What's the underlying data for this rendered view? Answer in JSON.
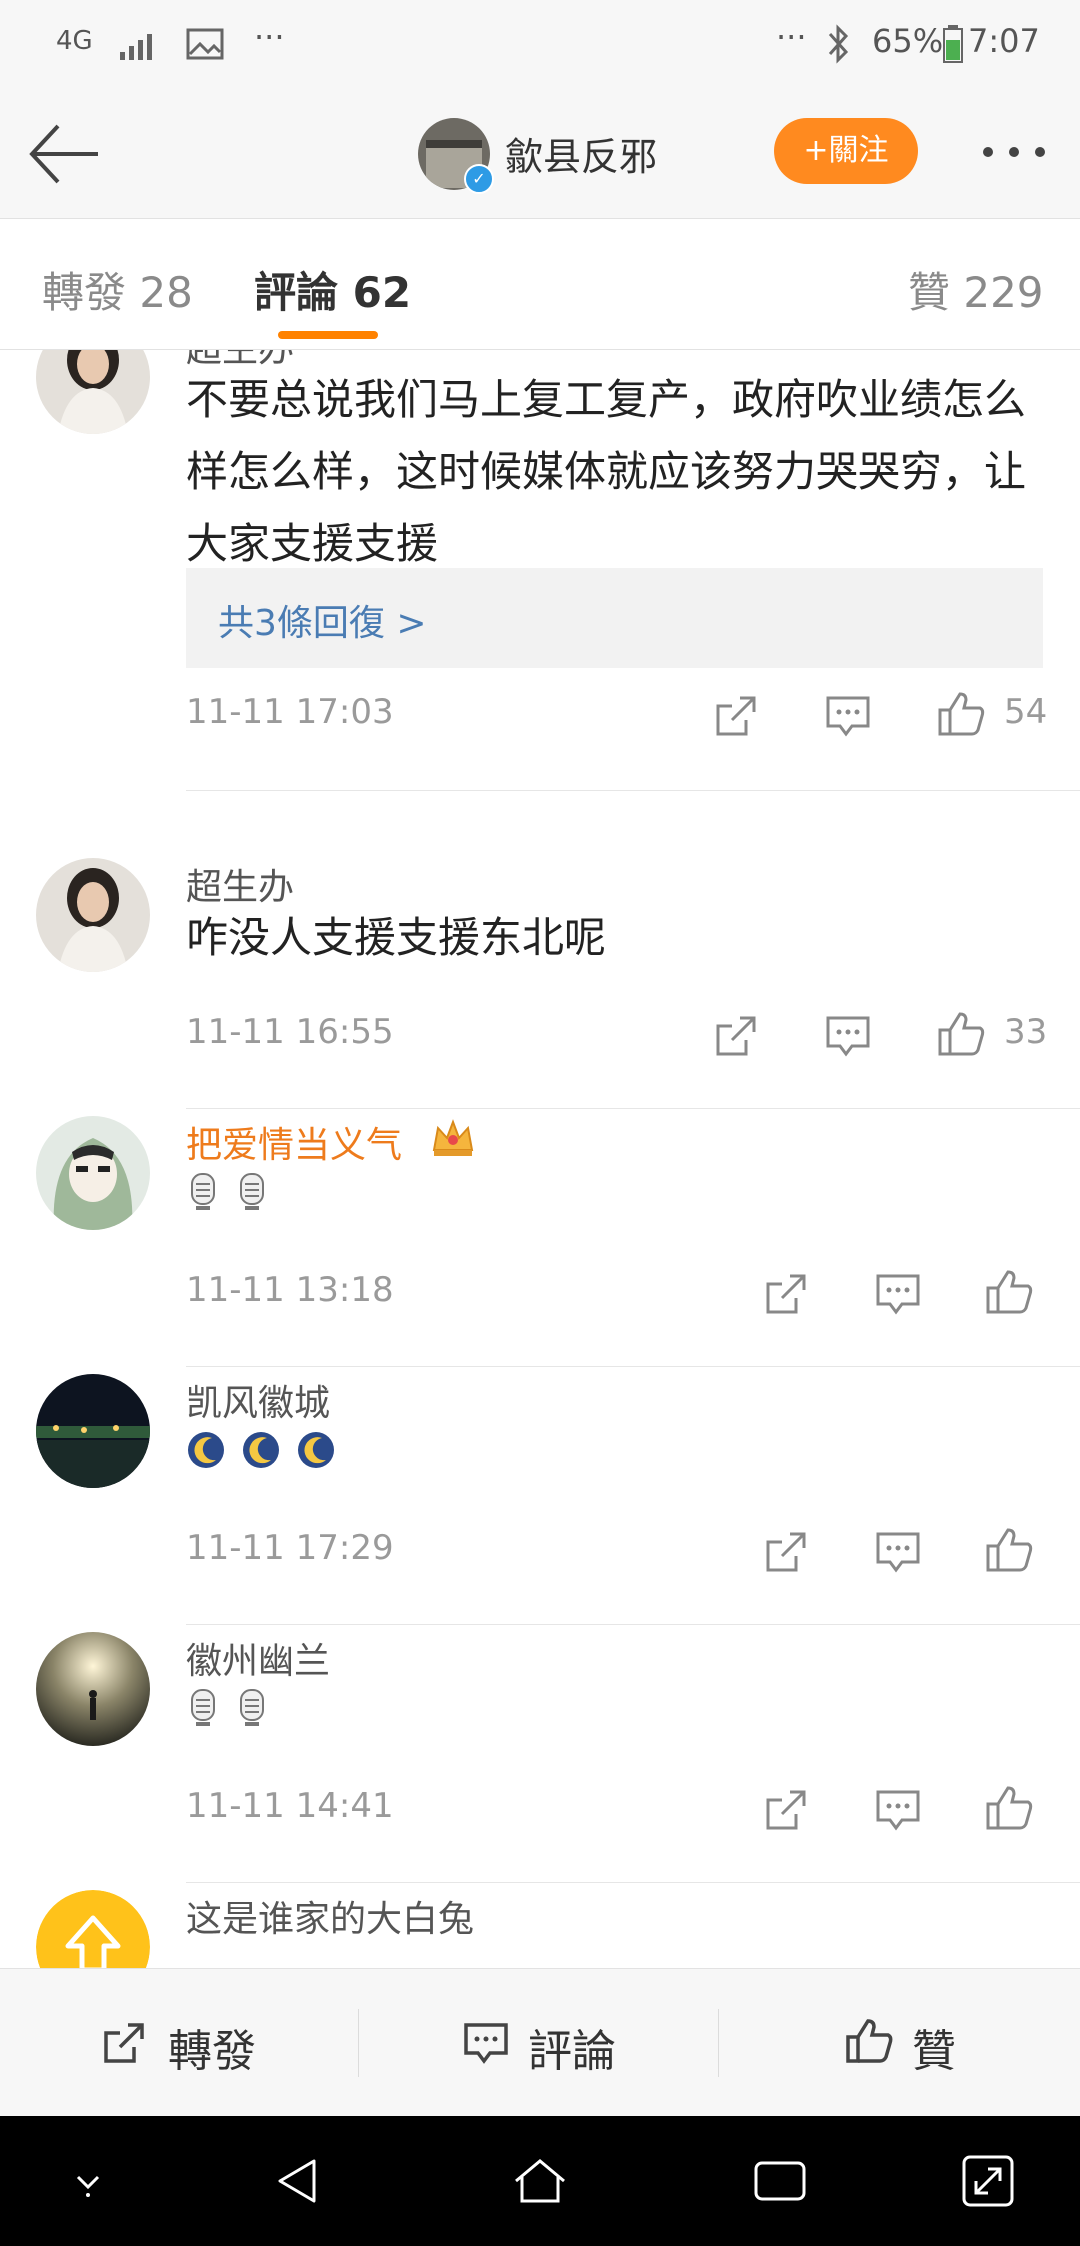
{
  "status_bar": {
    "network": "4G",
    "dots_left": "···",
    "dots_right": "···",
    "battery": "65%",
    "time": "7:07"
  },
  "header": {
    "account_name": "歙县反邪",
    "follow_label": "+關注"
  },
  "tabs": {
    "repost": "轉發 28",
    "comment": "評論 62",
    "like": "贊 229"
  },
  "comments": [
    {
      "name": "超生办",
      "text": "不要总说我们马上复工复产，政府吹业绩怎么样怎么样，这时候媒体就应该努力哭哭穷，让大家支援支援",
      "reply_link": "共3條回復 >",
      "time": "11-11 17:03",
      "likes": "54"
    },
    {
      "name": "超生办",
      "text": "咋没人支援支援东北呢",
      "time": "11-11 16:55",
      "likes": "33"
    },
    {
      "name": "把爱情当义气",
      "time": "11-11 13:18",
      "emoji": [
        "microphone-emoji",
        "microphone-emoji"
      ]
    },
    {
      "name": "凯风徽城",
      "time": "11-11 17:29",
      "emoji": [
        "moon-emoji",
        "moon-emoji",
        "moon-emoji"
      ]
    },
    {
      "name": "徽州幽兰",
      "time": "11-11 14:41",
      "emoji": [
        "microphone-emoji",
        "microphone-emoji"
      ]
    },
    {
      "name": "这是谁家的大白兔"
    }
  ],
  "bottom_bar": {
    "repost": "轉發",
    "comment": "評論",
    "like": "贊"
  },
  "colors": {
    "accent_orange": "#ff8200",
    "vip_name": "#ee7b1c",
    "link_blue": "#4a7cb3"
  }
}
